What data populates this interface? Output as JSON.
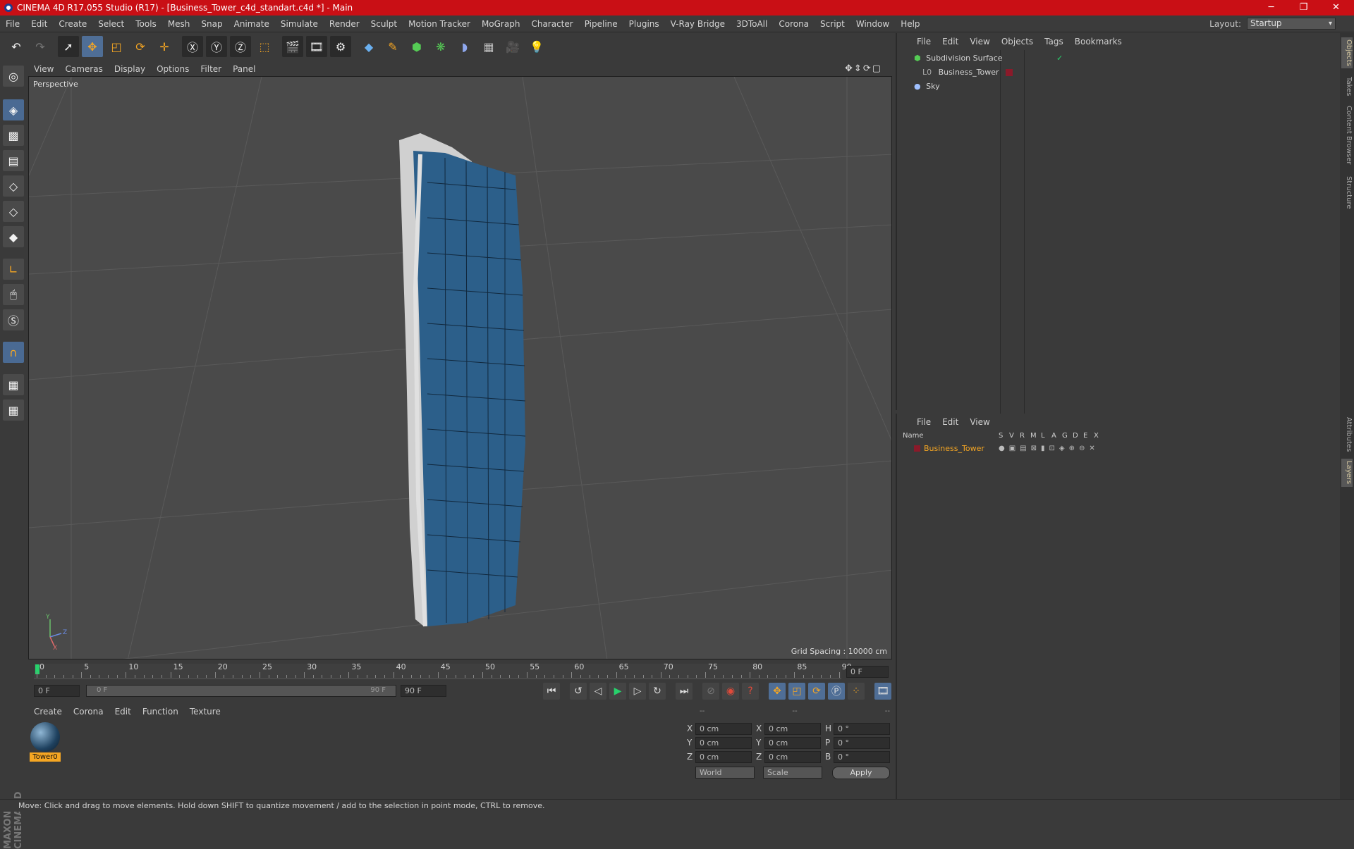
{
  "window": {
    "title": "CINEMA 4D R17.055 Studio (R17) - [Business_Tower_c4d_standart.c4d *] - Main",
    "min": "─",
    "max": "❐",
    "close": "✕"
  },
  "menu": [
    "File",
    "Edit",
    "Create",
    "Select",
    "Tools",
    "Mesh",
    "Snap",
    "Animate",
    "Simulate",
    "Render",
    "Sculpt",
    "Motion Tracker",
    "MoGraph",
    "Character",
    "Pipeline",
    "Plugins",
    "V-Ray Bridge",
    "3DToAll",
    "Corona",
    "Script",
    "Window",
    "Help"
  ],
  "layout": {
    "label": "Layout:",
    "value": "Startup"
  },
  "viewport": {
    "menu": [
      "View",
      "Cameras",
      "Display",
      "Options",
      "Filter",
      "Panel"
    ],
    "label": "Perspective",
    "grid_spacing": "Grid Spacing : 10000 cm",
    "axis": {
      "y": "Y",
      "z": "Z",
      "x": "X"
    }
  },
  "timeline": {
    "ticks": [
      "0",
      "5",
      "10",
      "15",
      "20",
      "25",
      "30",
      "35",
      "40",
      "45",
      "50",
      "55",
      "60",
      "65",
      "70",
      "75",
      "80",
      "85",
      "90"
    ],
    "current": "0 F",
    "start": "0 F",
    "slider_left": "0 F",
    "slider_right": "90 F",
    "end": "90 F"
  },
  "material": {
    "menu": [
      "Create",
      "Corona",
      "Edit",
      "Function",
      "Texture"
    ],
    "items": [
      "Tower0"
    ]
  },
  "coords": {
    "headers": [
      "--",
      "--",
      "--"
    ],
    "rows": [
      {
        "a": "X",
        "av": "0 cm",
        "b": "X",
        "bv": "0 cm",
        "c": "H",
        "cv": "0 °"
      },
      {
        "a": "Y",
        "av": "0 cm",
        "b": "Y",
        "bv": "0 cm",
        "c": "P",
        "cv": "0 °"
      },
      {
        "a": "Z",
        "av": "0 cm",
        "b": "Z",
        "bv": "0 cm",
        "c": "B",
        "cv": "0 °"
      }
    ],
    "space": "World",
    "mode": "Scale",
    "apply": "Apply"
  },
  "objects": {
    "menu": [
      "File",
      "Edit",
      "View",
      "Objects",
      "Tags",
      "Bookmarks"
    ],
    "items": [
      "Subdivision Surface",
      "Business_Tower",
      "Sky"
    ]
  },
  "layers": {
    "menu": [
      "File",
      "Edit",
      "View"
    ],
    "header": {
      "name": "Name",
      "cols": [
        "S",
        "V",
        "R",
        "M",
        "L",
        "A",
        "G",
        "D",
        "E",
        "X"
      ]
    },
    "items": [
      "Business_Tower"
    ]
  },
  "right_tabs": [
    "Objects",
    "Takes",
    "Content Browser",
    "Structure",
    "Attributes",
    "Layers"
  ],
  "brand": "MAXON CINEMA 4D",
  "status": "Move: Click and drag to move elements. Hold down SHIFT to quantize movement / add to the selection in point mode, CTRL to remove.",
  "colors": {
    "title_bar": "#c90f15",
    "accent_orange": "#f5a623",
    "tool_blue": "#4f6e96",
    "layer_red": "#8b1a2a"
  }
}
